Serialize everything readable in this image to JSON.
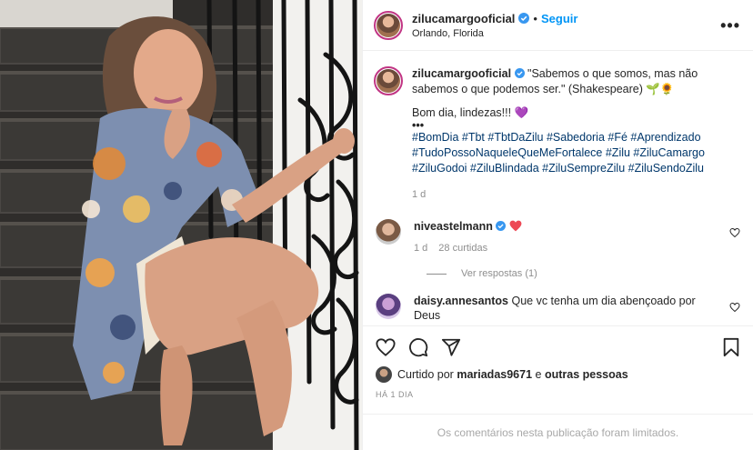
{
  "post": {
    "username": "zilucamargooficial",
    "follow_label": "Seguir",
    "location": "Orlando, Florida",
    "more_label": "•••",
    "image_alt": "Mulher sentada em uma escada com vestido estampado"
  },
  "caption": {
    "username": "zilucamargooficial",
    "quote": "\"Sabemos o que somos, mas não sabemos o que podemos ser.\" (Shakespeare) 🌱🌻",
    "greeting": "Bom dia, lindezas!!! 💜",
    "dots": "•••",
    "hashtags": "#BomDia #Tbt #TbtDaZilu #Sabedoria #Fé #Aprendizado #TudoPossoNaqueleQueMeFortalece #Zilu #ZiluCamargo #ZiluGodoi #ZiluBlindada #ZiluSempreZilu #ZiluSendoZilu",
    "age": "1 d"
  },
  "comments": [
    {
      "username": "niveastelmann",
      "text": "",
      "age": "1 d",
      "likes": "28 curtidas",
      "view_replies": "Ver respostas (1)"
    },
    {
      "username": "daisy.annesantos",
      "text": "Que vc tenha um dia abençoado por Deus"
    }
  ],
  "engagement": {
    "liked_by_prefix": "Curtido por",
    "liked_by_user": "mariadas9671",
    "liked_by_suffix": "e",
    "others": "outras pessoas",
    "time": "HÁ 1 DIA"
  },
  "footer": {
    "limited_text": "Os comentários nesta publicação foram limitados."
  },
  "colors": {
    "accent": "#0095f6",
    "hashtag": "#00376b",
    "verified": "#3897f0",
    "heart": "#ed4956",
    "purple_heart": "#8a5cd6"
  }
}
